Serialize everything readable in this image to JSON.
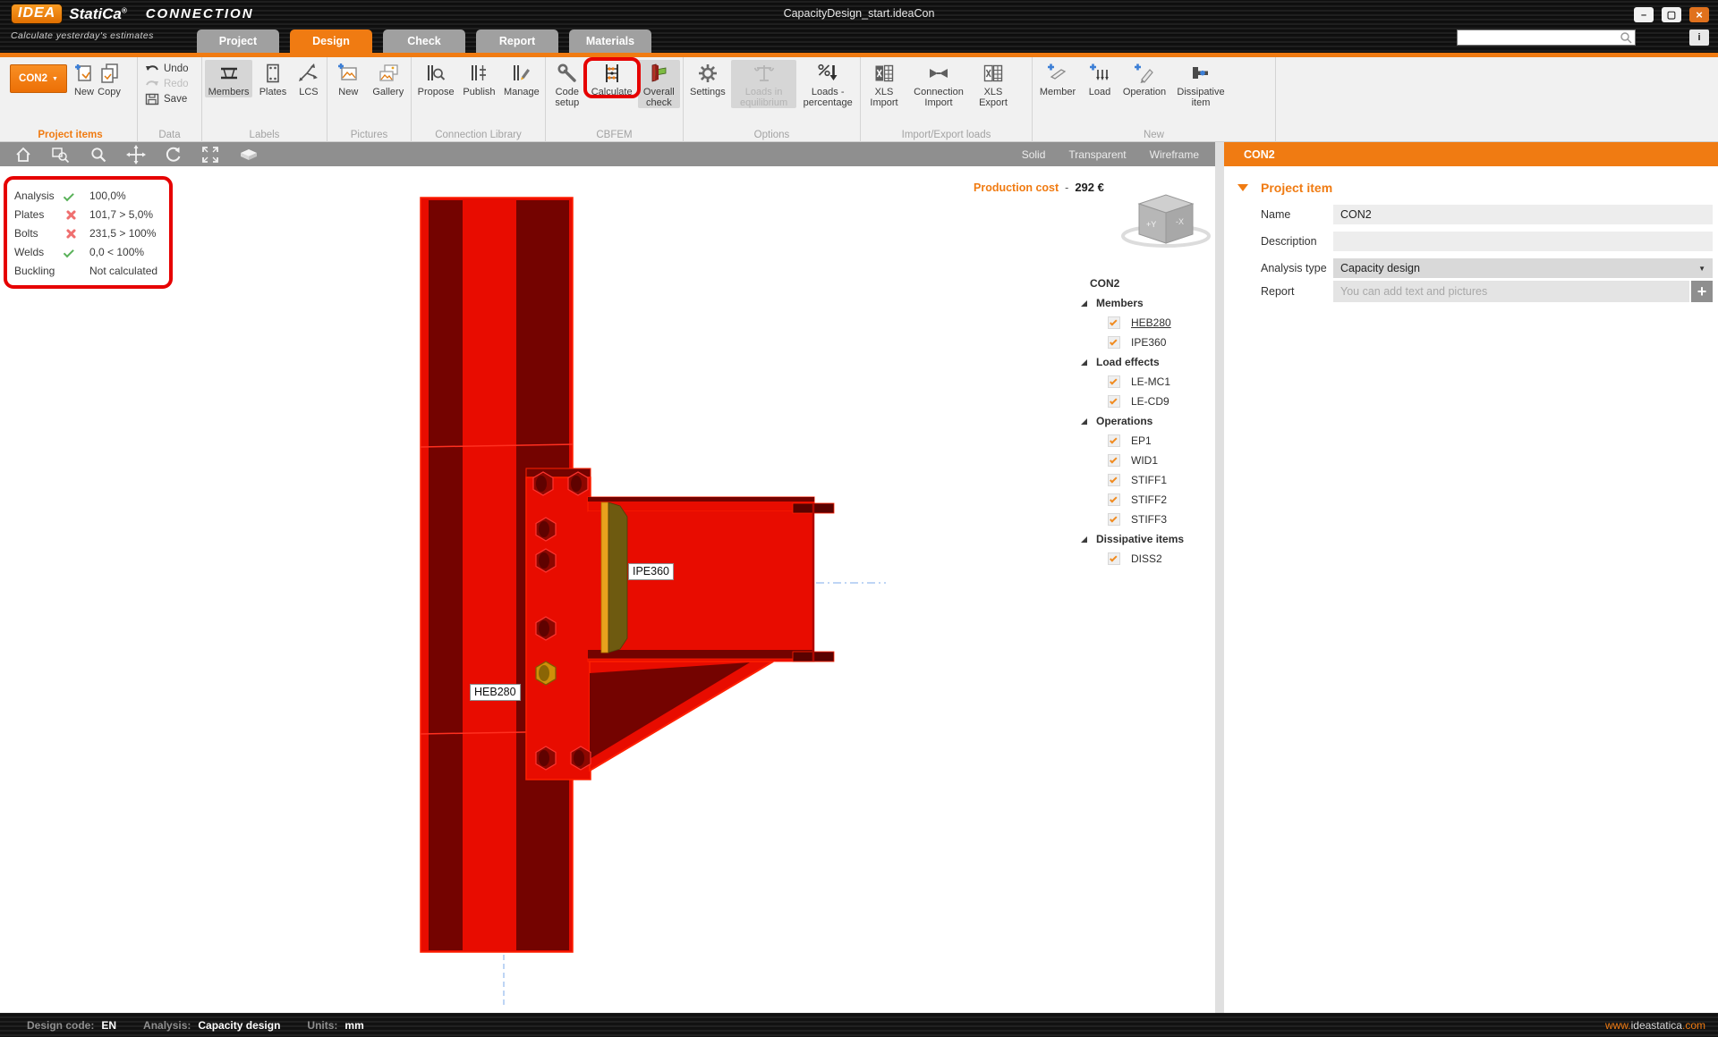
{
  "titlebar": {
    "logo_idea": "IDEA",
    "logo_statica": "StatiCa",
    "logo_reg": "®",
    "app_name": "CONNECTION",
    "tagline": "Calculate yesterday's estimates",
    "document_title": "CapacityDesign_start.ideaCon",
    "minimize": "–",
    "maximize": "▢",
    "close": "×",
    "info_button": "i"
  },
  "tabs": {
    "project": "Project",
    "design": "Design",
    "check": "Check",
    "report": "Report",
    "materials": "Materials"
  },
  "ribbon": {
    "con2": "CON2",
    "new_item": "New",
    "copy": "Copy",
    "undo": "Undo",
    "redo": "Redo",
    "save": "Save",
    "members": "Members",
    "plates": "Plates",
    "lcs": "LCS",
    "new_picture": "New",
    "gallery": "Gallery",
    "propose": "Propose",
    "publish": "Publish",
    "manage": "Manage",
    "code_setup": "Code setup",
    "calculate": "Calculate",
    "overall_check": "Overall check",
    "settings": "Settings",
    "loads_in_equilibrium": "Loads in equilibrium",
    "loads_percentage": "Loads - percentage",
    "xls_import": "XLS Import",
    "connection_import": "Connection Import",
    "xls_export": "XLS Export",
    "member": "Member",
    "load": "Load",
    "operation": "Operation",
    "dissipative_item": "Dissipative item",
    "captions": {
      "project_items": "Project items",
      "data": "Data",
      "labels": "Labels",
      "pictures": "Pictures",
      "connection_library": "Connection Library",
      "cbfem": "CBFEM",
      "options": "Options",
      "import_export": "Import/Export loads",
      "new": "New"
    }
  },
  "viewport": {
    "toolbar": {
      "solid": "Solid",
      "transparent": "Transparent",
      "wireframe": "Wireframe"
    },
    "overlay": {
      "rows": [
        {
          "label": "Analysis",
          "value": "100,0%",
          "status": "pass"
        },
        {
          "label": "Plates",
          "value": "101,7 > 5,0%",
          "status": "fail"
        },
        {
          "label": "Bolts",
          "value": "231,5 > 100%",
          "status": "fail"
        },
        {
          "label": "Welds",
          "value": "0,0 < 100%",
          "status": "pass"
        },
        {
          "label": "Buckling",
          "value": "Not calculated",
          "status": "none"
        }
      ]
    },
    "production_cost": {
      "label": "Production cost",
      "dash": "-",
      "value": "292 €"
    },
    "nav_cube": {
      "left_face": "+Y",
      "right_face": "-X"
    },
    "model_labels": {
      "beam": "IPE360",
      "column": "HEB280"
    }
  },
  "tree": {
    "root": "CON2",
    "groups": [
      {
        "label": "Members",
        "items": [
          "HEB280",
          "IPE360"
        ]
      },
      {
        "label": "Load effects",
        "items": [
          "LE-MC1",
          "LE-CD9"
        ]
      },
      {
        "label": "Operations",
        "items": [
          "EP1",
          "WID1",
          "STIFF1",
          "STIFF2",
          "STIFF3"
        ]
      },
      {
        "label": "Dissipative items",
        "items": [
          "DISS2"
        ]
      }
    ]
  },
  "panel": {
    "header": "CON2",
    "section": "Project item",
    "name_label": "Name",
    "name_value": "CON2",
    "description_label": "Description",
    "description_value": "",
    "analysis_type_label": "Analysis type",
    "analysis_type_value": "Capacity design",
    "report_label": "Report",
    "report_placeholder": "You can add text and pictures"
  },
  "statusbar": {
    "design_code_label": "Design code:",
    "design_code_value": "EN",
    "analysis_label": "Analysis:",
    "analysis_value": "Capacity design",
    "units_label": "Units:",
    "units_value": "mm",
    "site_prefix": "www.",
    "site_name": "ideastatica",
    "site_suffix": ".com"
  },
  "colors": {
    "accent": "#f07b12",
    "model_red": "#e80c00",
    "model_dark_red": "#740300",
    "gold": "#d79a1e",
    "annotation": "#e60000",
    "pass_green": "#58b158",
    "fail_red": "#ef6f6f"
  }
}
